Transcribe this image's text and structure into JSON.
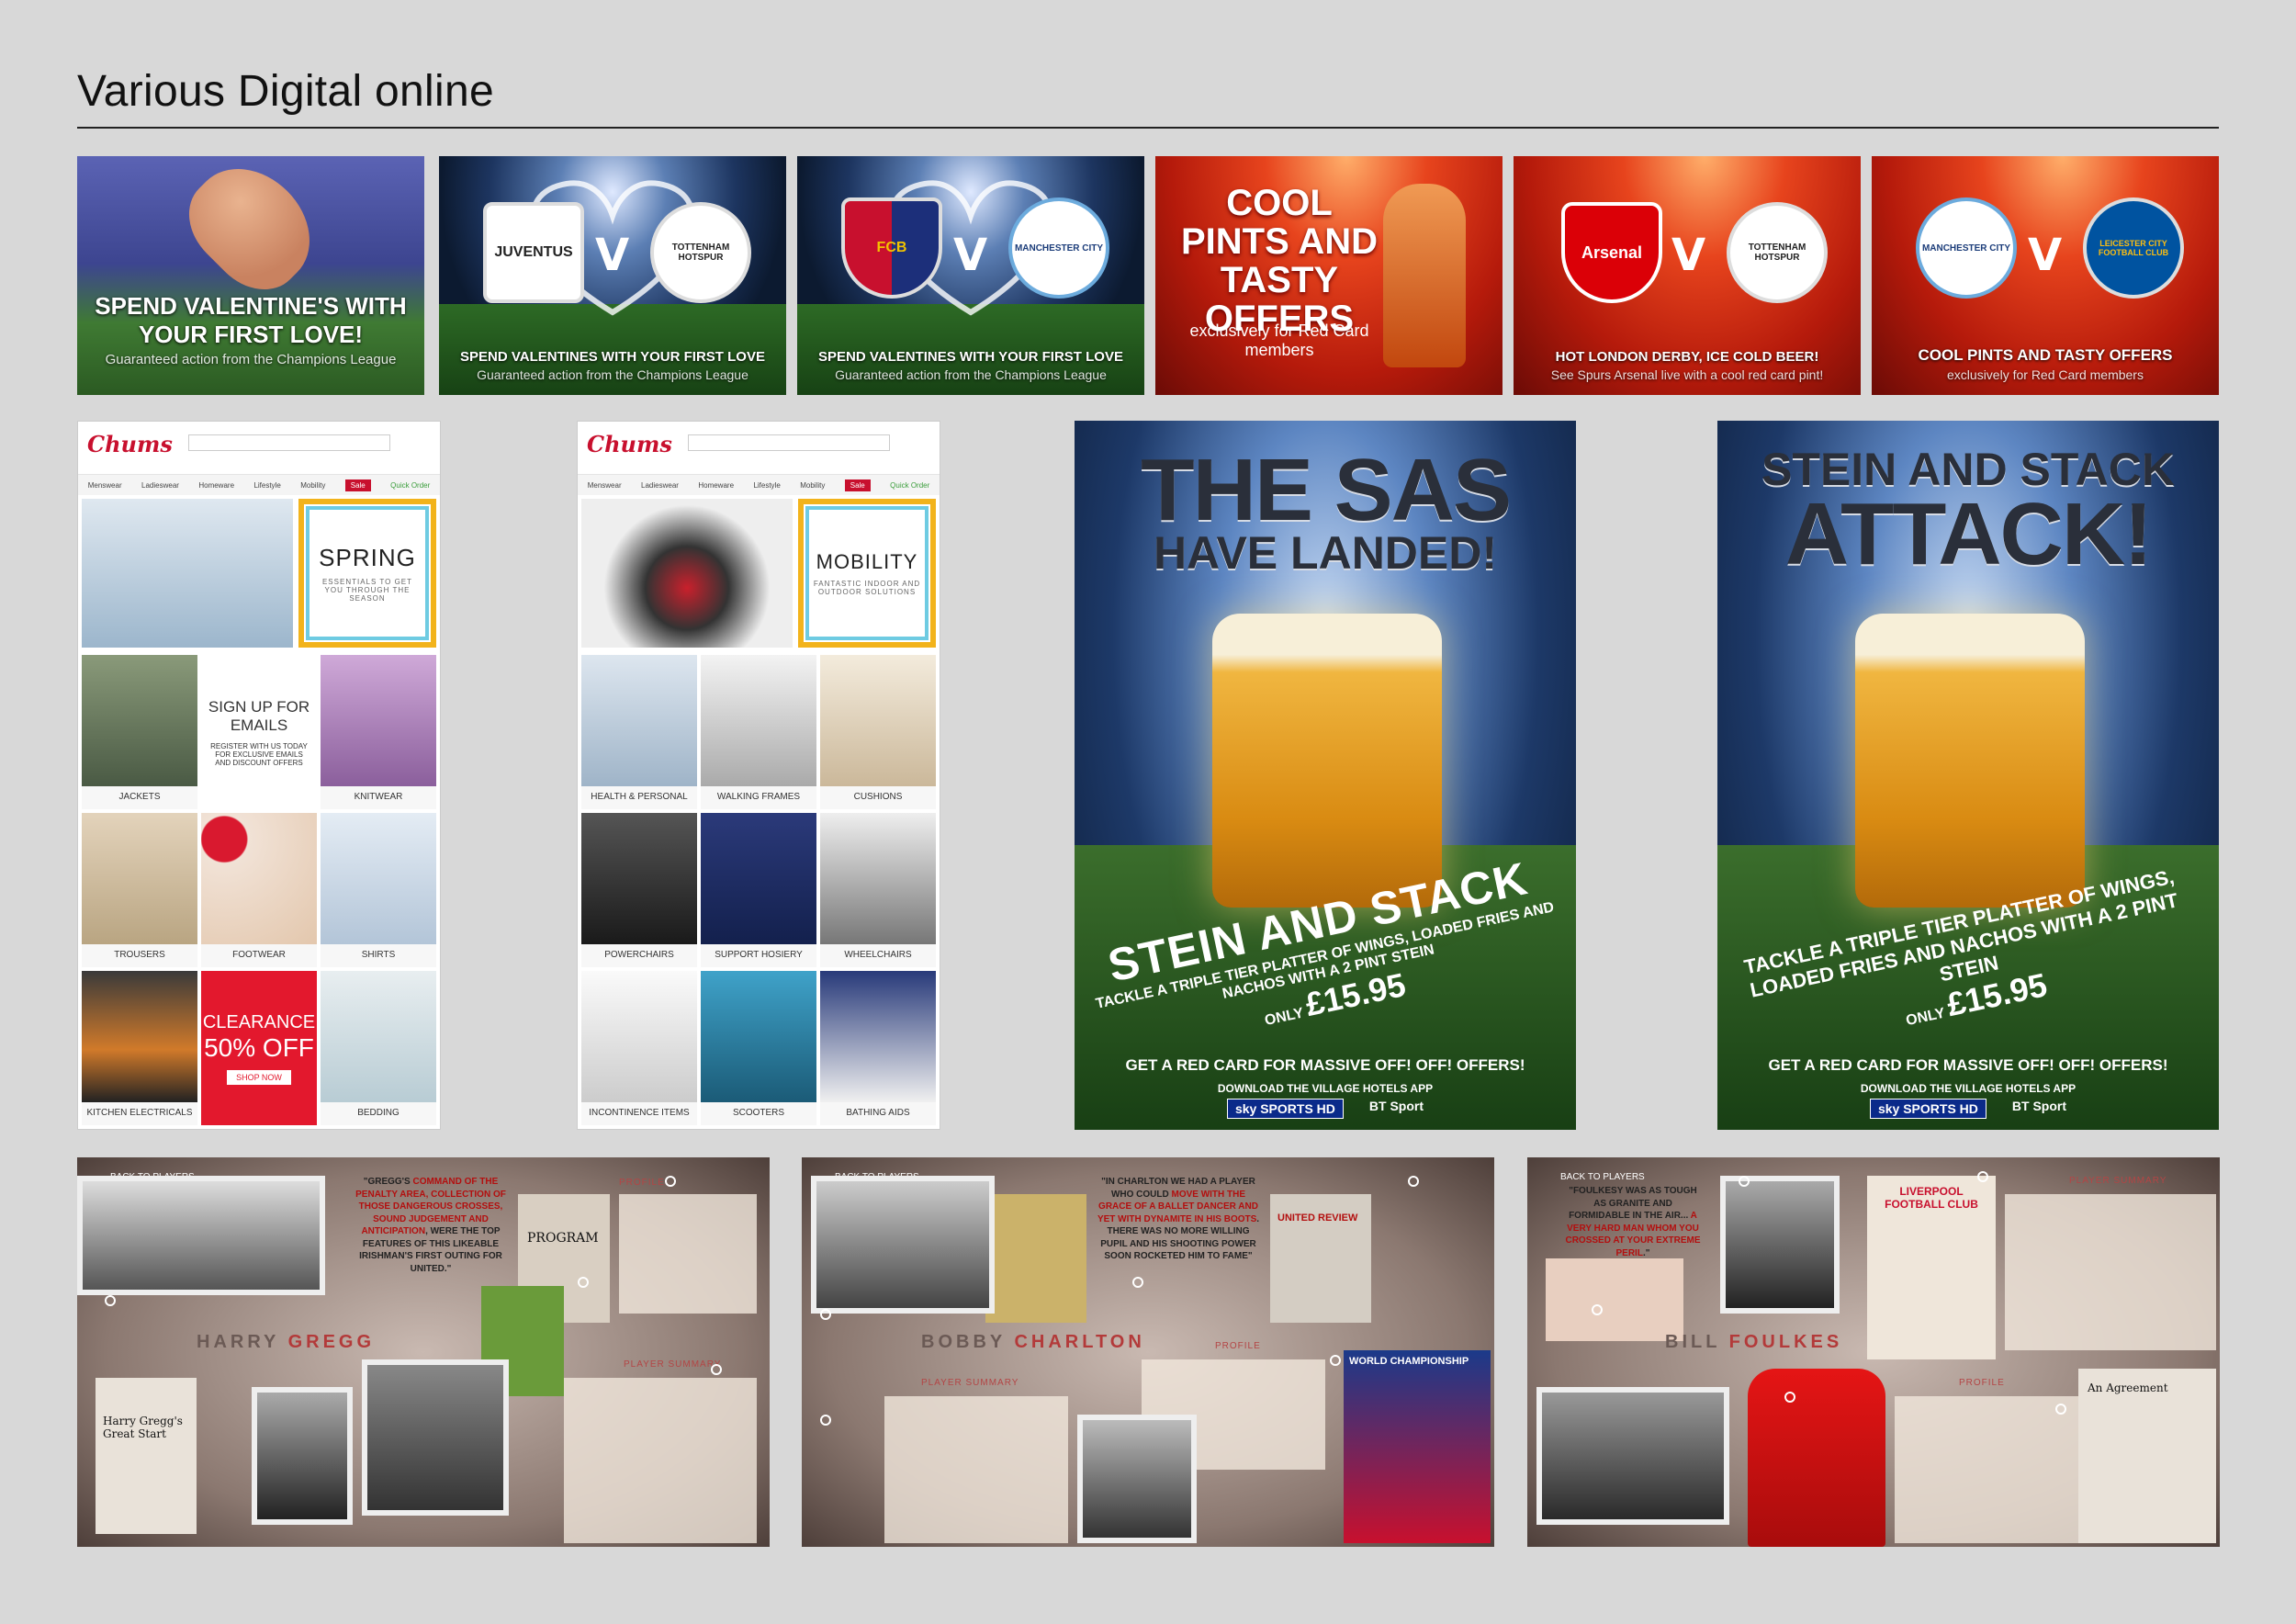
{
  "page": {
    "title": "Various Digital online"
  },
  "banners": [
    {
      "headline": "SPEND VALENTINE'S WITH YOUR FIRST LOVE!",
      "sub": "Guaranteed action from the Champions League"
    },
    {
      "team1": "JUVENTUS",
      "vs": "V",
      "team2": "TOTTENHAM HOTSPUR",
      "headline": "SPEND VALENTINES WITH YOUR FIRST LOVE",
      "sub": "Guaranteed action from the Champions League"
    },
    {
      "team1": "FCB",
      "vs": "V",
      "team2": "MANCHESTER CITY",
      "headline": "SPEND VALENTINES WITH YOUR FIRST LOVE",
      "sub": "Guaranteed action from the Champions League"
    },
    {
      "headline": "COOL PINTS AND TASTY OFFERS",
      "sub": "exclusively for Red Card members"
    },
    {
      "team1": "Arsenal",
      "vs": "V",
      "team2": "TOTTENHAM HOTSPUR",
      "headline": "HOT LONDON DERBY, ICE COLD BEER!",
      "sub": "See Spurs Arsenal live with a cool red card pint!"
    },
    {
      "team1": "MANCHESTER CITY",
      "vs": "V",
      "team2": "LEICESTER CITY FOOTBALL CLUB",
      "headline": "COOL PINTS AND TASTY OFFERS",
      "sub": "exclusively for Red Card members"
    }
  ],
  "site1": {
    "logo": "Chums",
    "nav": [
      "Menswear",
      "Ladieswear",
      "Homeware",
      "Lifestyle",
      "Mobility",
      "Sale",
      "Quick Order"
    ],
    "hero": {
      "title": "SPRING",
      "sub": "ESSENTIALS TO GET YOU THROUGH THE SEASON"
    },
    "promo": {
      "title": "SIGN UP FOR EMAILS",
      "sub": "REGISTER WITH US TODAY FOR EXCLUSIVE EMAILS AND DISCOUNT OFFERS"
    },
    "cells": [
      "JACKETS",
      "KNITWEAR",
      "TROUSERS",
      "FOOTWEAR",
      "SHIRTS",
      "KITCHEN ELECTRICALS",
      "BEDDING"
    ],
    "clearance": {
      "title": "CLEARANCE",
      "pct": "50% OFF",
      "cta": "SHOP NOW"
    }
  },
  "site2": {
    "logo": "Chums",
    "nav": [
      "Menswear",
      "Ladieswear",
      "Homeware",
      "Lifestyle",
      "Mobility",
      "Sale",
      "Quick Order"
    ],
    "hero": {
      "title": "MOBILITY",
      "sub": "FANTASTIC INDOOR AND OUTDOOR SOLUTIONS"
    },
    "cells": [
      "HEALTH & PERSONAL",
      "WALKING FRAMES",
      "CUSHIONS",
      "POWERCHAIRS",
      "SUPPORT HOSIERY",
      "WHEELCHAIRS",
      "INCONTINENCE ITEMS",
      "SCOOTERS",
      "BATHING AIDS"
    ]
  },
  "posters": [
    {
      "head1": "THE SAS",
      "head2": "HAVE LANDED!",
      "offer": "STEIN AND STACK",
      "desc": "TACKLE A TRIPLE TIER PLATTER OF WINGS, LOADED FRIES AND NACHOS WITH A 2 PINT STEIN",
      "price_prefix": "ONLY",
      "price": "£15.95",
      "cta": "GET A RED CARD FOR MASSIVE OFF! OFF! OFFERS!",
      "cta2": "DOWNLOAD THE VILLAGE HOTELS APP",
      "logo1": "sky SPORTS HD",
      "logo2": "BT Sport"
    },
    {
      "head1": "ATTACK!",
      "head2": "STEIN AND STACK",
      "offer": "",
      "desc": "TACKLE A TRIPLE TIER PLATTER OF WINGS, LOADED FRIES AND NACHOS WITH A 2 PINT STEIN",
      "price_prefix": "ONLY",
      "price": "£15.95",
      "cta": "GET A RED CARD FOR MASSIVE OFF! OFF! OFFERS!",
      "cta2": "DOWNLOAD THE VILLAGE HOTELS APP",
      "logo1": "sky SPORTS HD",
      "logo2": "BT Sport"
    }
  ],
  "scrapbooks": [
    {
      "back": "BACK TO PLAYERS",
      "first": "HARRY",
      "last": "GREGG",
      "quote_a": "\"GREGG'S ",
      "quote_red": "COMMAND OF THE PENALTY AREA, COLLECTION OF THOSE DANGEROUS CROSSES, SOUND JUDGEMENT AND ANTICIPATION",
      "quote_b": ", WERE THE TOP FEATURES OF THIS LIKEABLE IRISHMAN'S FIRST OUTING FOR UNITED.\"",
      "profile": "PROFILE",
      "summary": "PLAYER SUMMARY",
      "program": "PROGRAM",
      "book": "Harry Gregg's Great Start"
    },
    {
      "back": "BACK TO PLAYERS",
      "first": "BOBBY",
      "last": "CHARLTON",
      "quote_a": "\"IN CHARLTON WE HAD A PLAYER WHO COULD ",
      "quote_red": "MOVE WITH THE GRACE OF A BALLET DANCER AND YET WITH DYNAMITE IN HIS BOOTS",
      "quote_b": ". THERE WAS NO MORE WILLING PUPIL AND HIS SHOOTING POWER SOON ROCKETED HIM TO FAME\"",
      "profile": "PROFILE",
      "summary": "PLAYER SUMMARY",
      "program": "UNITED REVIEW",
      "book": "WORLD CHAMPIONSHIP"
    },
    {
      "back": "BACK TO PLAYERS",
      "first": "BILL",
      "last": "FOULKES",
      "quote_a": "\"FOULKESY WAS AS TOUGH AS GRANITE AND FORMIDABLE IN THE AIR... ",
      "quote_red": "A VERY HARD MAN WHOM YOU CROSSED AT YOUR EXTREME PERIL",
      "quote_b": ".\"",
      "profile": "PROFILE",
      "summary": "PLAYER SUMMARY",
      "program": "LIVERPOOL FOOTBALL CLUB",
      "book": "An Agreement"
    }
  ],
  "colors": {
    "bg": "#d8d8d8",
    "red": "#c8102e",
    "accent_gold": "#f2b31b"
  }
}
